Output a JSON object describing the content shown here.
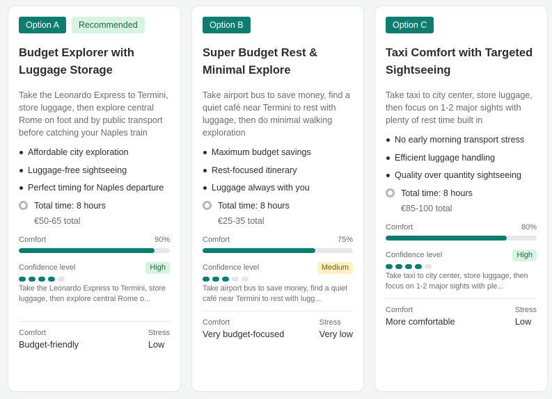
{
  "colors": {
    "accent": "#0e7c6e",
    "recommended_bg": "#d8f3e1",
    "medium_bg": "#fcf2c4",
    "clock_ring": "#b3b8be"
  },
  "icons": {
    "time": "clock-icon"
  },
  "options": [
    {
      "badge": "Option A",
      "recommended": "Recommended",
      "title": "Budget Explorer with Luggage Storage",
      "description": "Take the Leonardo Express to Termini, store luggage, then explore central Rome on foot and by public transport before catching your Naples train",
      "benefits": [
        "Affordable city exploration",
        "Luggage-free sightseeing",
        "Perfect timing for Naples departure"
      ],
      "total_time": "Total time: 8 hours",
      "cost": "€50-65 total",
      "comfort_label": "Comfort",
      "comfort_value": 90,
      "comfort_display": "90%",
      "confidence_label": "Confidence level",
      "confidence": "High",
      "confidence_dots_filled": 4,
      "confidence_dots_total": 5,
      "summary": "Take the Leonardo Express to Termini, store luggage, then explore central Rome o...",
      "footer_comfort_label": "Comfort",
      "footer_comfort": "Budget-friendly",
      "footer_stress_label": "Stress",
      "footer_stress": "Low"
    },
    {
      "badge": "Option B",
      "recommended": "",
      "title": "Super Budget Rest & Minimal Explore",
      "description": "Take airport bus to save money, find a quiet café near Termini to rest with luggage, then do minimal walking exploration",
      "benefits": [
        "Maximum budget savings",
        "Rest-focused itinerary",
        "Luggage always with you"
      ],
      "total_time": "Total time: 8 hours",
      "cost": "€25-35 total",
      "comfort_label": "Comfort",
      "comfort_value": 75,
      "comfort_display": "75%",
      "confidence_label": "Confidence level",
      "confidence": "Medium",
      "confidence_dots_filled": 3,
      "confidence_dots_total": 5,
      "summary": "Take airport bus to save money, find a quiet café near Termini to rest with lugg...",
      "footer_comfort_label": "Comfort",
      "footer_comfort": "Very budget-focused",
      "footer_stress_label": "Stress",
      "footer_stress": "Very low"
    },
    {
      "badge": "Option C",
      "recommended": "",
      "title": "Taxi Comfort with Targeted Sightseeing",
      "description": "Take taxi to city center, store luggage, then focus on 1-2 major sights with plenty of rest time built in",
      "benefits": [
        "No early morning transport stress",
        "Efficient luggage handling",
        "Quality over quantity sightseeing"
      ],
      "total_time": "Total time: 8 hours",
      "cost": "€85-100 total",
      "comfort_label": "Comfort",
      "comfort_value": 80,
      "comfort_display": "80%",
      "confidence_label": "Confidence level",
      "confidence": "High",
      "confidence_dots_filled": 4,
      "confidence_dots_total": 5,
      "summary": "Take taxi to city center, store luggage, then focus on 1-2 major sights with ple...",
      "footer_comfort_label": "Comfort",
      "footer_comfort": "More comfortable",
      "footer_stress_label": "Stress",
      "footer_stress": "Low"
    }
  ]
}
